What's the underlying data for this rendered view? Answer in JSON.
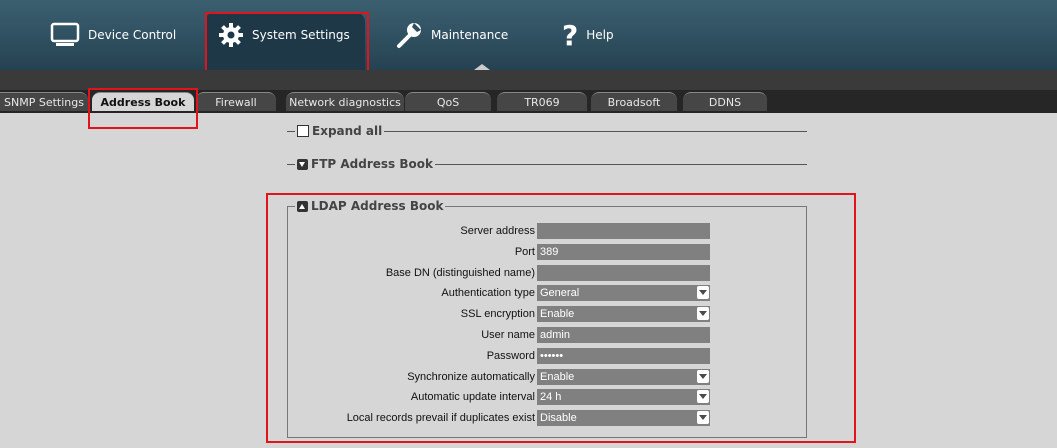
{
  "nav": {
    "items": [
      {
        "label": "Device Control",
        "icon": "monitor-icon"
      },
      {
        "label": "System Settings",
        "icon": "gear-icon"
      },
      {
        "label": "Maintenance",
        "icon": "wrench-icon"
      },
      {
        "label": "Help",
        "icon": "question-icon"
      }
    ],
    "active": "System Settings"
  },
  "tabs": [
    {
      "label": "SNMP Settings"
    },
    {
      "label": "Address Book",
      "active": true
    },
    {
      "label": "Firewall"
    },
    {
      "label": "Network diagnostics"
    },
    {
      "label": "QoS"
    },
    {
      "label": "TR069"
    },
    {
      "label": "Broadsoft"
    },
    {
      "label": "DDNS"
    }
  ],
  "sections": {
    "expand_all": "Expand all",
    "ftp": "FTP Address Book",
    "ldap": "LDAP Address Book"
  },
  "ldap_fields": [
    {
      "label": "Server address",
      "value": "",
      "type": "text"
    },
    {
      "label": "Port",
      "value": "389",
      "type": "text"
    },
    {
      "label": "Base DN (distinguished name)",
      "value": "",
      "type": "text"
    },
    {
      "label": "Authentication type",
      "value": "General",
      "type": "select"
    },
    {
      "label": "SSL encryption",
      "value": "Enable",
      "type": "select"
    },
    {
      "label": "User name",
      "value": "admin",
      "type": "text"
    },
    {
      "label": "Password",
      "value": "••••••",
      "type": "password"
    },
    {
      "label": "Synchronize automatically",
      "value": "Enable",
      "type": "select"
    },
    {
      "label": "Automatic update interval",
      "value": "24 h",
      "type": "select"
    },
    {
      "label": "Local records prevail if duplicates exist",
      "value": "Disable",
      "type": "select"
    }
  ],
  "colors": {
    "highlight": "#e0141a",
    "nav_bg": "#2d4f5f"
  }
}
